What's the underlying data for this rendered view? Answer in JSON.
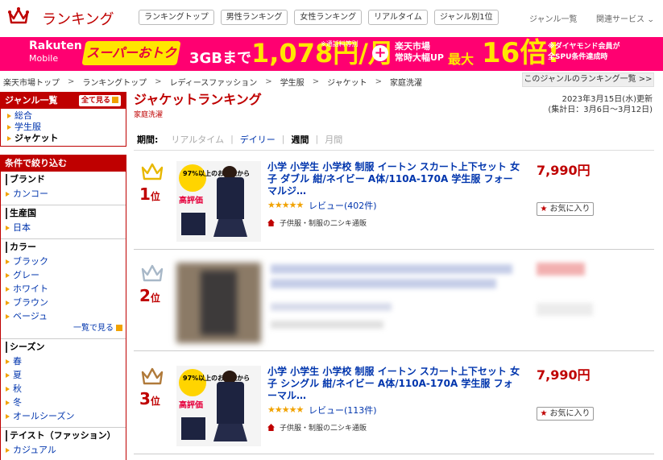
{
  "header": {
    "title": "ランキング",
    "nav": [
      "ランキングトップ",
      "男性ランキング",
      "女性ランキング",
      "リアルタイム",
      "ジャンル別1位"
    ],
    "genre_list": "ジャンル一覧",
    "related": "関連サービス"
  },
  "banner": {
    "brand": "Rakuten",
    "brand_sub": "Mobile",
    "super": "スーパーおトク",
    "gb": "3GBまで",
    "price": "1,078円/月",
    "note": "※通話料等別",
    "ichiba1": "楽天市場",
    "ichiba2": "常時大幅UP",
    "max": "最大",
    "times": "16倍!",
    "dia1": "※ダイヤモンド会員が",
    "dia2": "全SPU条件達成時"
  },
  "breadcrumb": [
    "楽天市場トップ",
    "ランキングトップ",
    "レディースファッション",
    "学生服",
    "ジャケット",
    "家庭洗濯"
  ],
  "breadcrumb_all": "このジャンルのランキング一覧 >>",
  "sidebar": {
    "genre_title": "ジャンル一覧",
    "all_btn": "全て見る",
    "genres": [
      "総合",
      "学生服",
      "ジャケット"
    ],
    "filter_title": "条件で絞り込む",
    "groups": [
      {
        "title": "ブランド",
        "items": [
          "カンコー"
        ]
      },
      {
        "title": "生産国",
        "items": [
          "日本"
        ]
      },
      {
        "title": "カラー",
        "items": [
          "ブラック",
          "グレー",
          "ホワイト",
          "ブラウン",
          "ベージュ"
        ],
        "more": "一覧で見る"
      },
      {
        "title": "シーズン",
        "items": [
          "春",
          "夏",
          "秋",
          "冬",
          "オールシーズン"
        ]
      },
      {
        "title": "テイスト（ファッション）",
        "items": [
          "カジュアル"
        ]
      }
    ]
  },
  "main": {
    "title": "ジャケットランキング",
    "subtitle": "家庭洗濯",
    "updated": "2023年3月15日(水)更新",
    "period_range": "(集計日：3月6日～3月12日)",
    "period_label": "期間:",
    "periods": [
      "リアルタイム",
      "デイリー",
      "週間",
      "月間"
    ],
    "active_period": "週間"
  },
  "items": [
    {
      "rank": "1",
      "rank_suffix": "位",
      "crown_color": "#e8b800",
      "title": "小学 小学生 小学校 制服 イートン スカート上下セット 女子 ダブル 紺/ネイビー A体/110A-170A 学生服 フォーマルジ…",
      "price": "7,990円",
      "review": "レビュー(402件)",
      "stars": "★★★★★",
      "shop": "子供服・制服の二シキ通販",
      "fav": "お気に入り",
      "thumb_tag": "97%以上のお客様から",
      "thumb_label": "高評価"
    },
    {
      "rank": "2",
      "rank_suffix": "位",
      "crown_color": "#a8b8c8",
      "title": "",
      "price": "",
      "review": "",
      "stars": "",
      "shop": "",
      "fav": "",
      "blurred": true
    },
    {
      "rank": "3",
      "rank_suffix": "位",
      "crown_color": "#b07a3a",
      "title": "小学 小学生 小学校 制服 イートン スカート上下セット 女子 シングル 紺/ネイビー A体/110A-170A 学生服 フォーマル…",
      "price": "7,990円",
      "review": "レビュー(113件)",
      "stars": "★★★★★",
      "shop": "子供服・制服の二シキ通販",
      "fav": "お気に入り",
      "thumb_tag": "97%以上のお客様から",
      "thumb_label": "高評価"
    }
  ]
}
